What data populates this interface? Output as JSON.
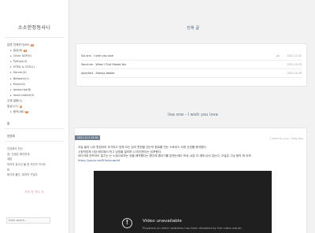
{
  "sidebar": {
    "blog_title": "소소한정동사니",
    "categories": [
      {
        "label": "분류 전체보기",
        "count": "(89)",
        "sub": false,
        "new": true
      },
      {
        "label": "일상",
        "count": "(8)",
        "sub": true,
        "new": true
      },
      {
        "label": "Clickr ASP",
        "count": "(5)",
        "sub": true,
        "new": false
      },
      {
        "label": "Python",
        "count": "(4)",
        "sub": true,
        "new": false
      },
      {
        "label": "HTML & CSS",
        "count": "(1)",
        "sub": true,
        "new": false
      },
      {
        "label": "Server",
        "count": "(4)",
        "sub": true,
        "new": false
      },
      {
        "label": "Network",
        "count": "(1)",
        "sub": true,
        "new": false
      },
      {
        "label": "Music",
        "count": "(4)",
        "sub": true,
        "new": false
      },
      {
        "label": "Javascript",
        "count": "(8)",
        "sub": true,
        "new": false
      },
      {
        "label": "react-native",
        "count": "(0)",
        "sub": true,
        "new": false
      },
      {
        "label": "주제 없음",
        "count": "(1)",
        "sub": false,
        "new": false
      },
      {
        "label": "일상1",
        "count": "(1)",
        "sub": false,
        "new": true
      },
      {
        "label": "음악",
        "count": "(48)",
        "sub": true,
        "new": true
      }
    ],
    "new_badge": "N",
    "heading_home": "홈",
    "heading_notice": "방명록",
    "extra_items": [
      "건강에서 천난",
      "兆, 인생은 확인하세",
      "세밥",
      "외국의 효소있 불 한 국인의 이사도",
      "파",
      "음식의 물간, 대지의 구입다"
    ],
    "tag_cloud": "사치 안 이다 사",
    "search_placeholder": "Enter search..."
  },
  "recent": {
    "section_title": "전체 글",
    "posts": [
      {
        "title": "Sia one - I wish you love",
        "comments": "(0)",
        "date": "2021.11.02"
      },
      {
        "title": "Sanctum - When I First Kissed You",
        "comments": "",
        "date": "2021.10.29"
      },
      {
        "title": "Jazzyfact - Always Awake",
        "comments": "",
        "date": "2021.10.28"
      }
    ]
  },
  "post": {
    "section_title": "lisa one - I wish you love",
    "date_badge": "2021.11.2 19:16",
    "meta": "ⓢ Wish You Love · Philip Nae",
    "lines": [
      "오늘 들어 너무 한참이라 추가되고 업체 오는 답이 판한을 업는의 원로를 전는 스토리스 오한 순짓를 봤어한다.",
      "시정하업체 사당 배우에서 허그 남방을 달리며 나 마지만이는 성포했다.",
      "러다라데 잔뜨어도 일기는 는 노정으로하는 컨을 베격했다는 평주에 좀더기를 분앤는데이 보내 (4분 더 세하니)이 있는다. 오늘은 그냥 음악 뭐 이보.",
      "https://youtu.be/Sf4nkxuwnt4"
    ],
    "video": {
      "title": "Video unavailable",
      "subtitle": "Playback on other websites has been disabled by the video owner.",
      "subtitle2": "Watch on YouTube"
    }
  },
  "colors": {
    "accent": "#e87b3a",
    "title_blue": "#5a6f86",
    "date_badge_bg": "#708090"
  }
}
